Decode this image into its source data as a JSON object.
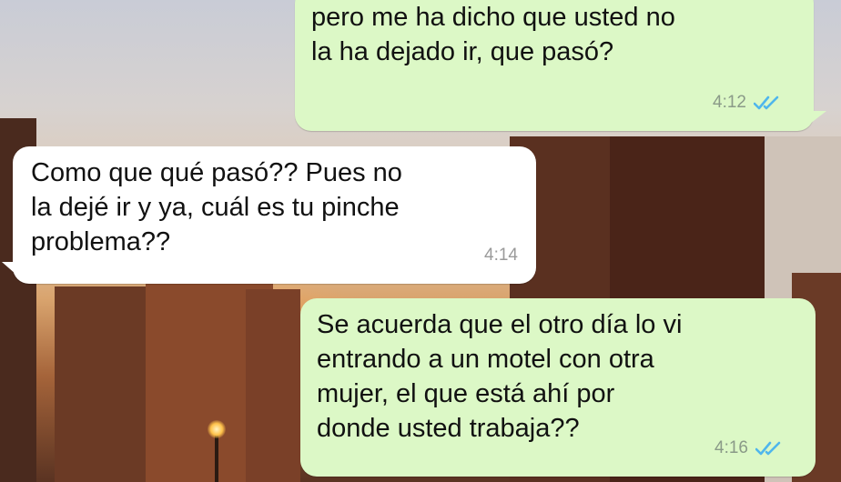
{
  "messages": [
    {
      "id": "m1",
      "direction": "outgoing",
      "text": "pero me ha dicho que usted no\nla ha dejado ir, que pasó?",
      "time": "4:12",
      "status": "read",
      "status_icon": "double-check-icon"
    },
    {
      "id": "m2",
      "direction": "incoming",
      "text": "Como que qué pasó?? Pues no\nla dejé ir y ya, cuál es tu pinche\nproblema??",
      "time": "4:14"
    },
    {
      "id": "m3",
      "direction": "outgoing",
      "text": "Se acuerda que el otro día lo vi\nentrando a un motel con otra\nmujer, el que está ahí por\ndonde usted trabaja??",
      "time": "4:16",
      "status": "read",
      "status_icon": "double-check-icon"
    }
  ],
  "colors": {
    "outgoing_bubble": "#dcf8c6",
    "incoming_bubble": "#ffffff",
    "read_ticks": "#4fb6ec",
    "timestamp": "#8a9a88"
  }
}
